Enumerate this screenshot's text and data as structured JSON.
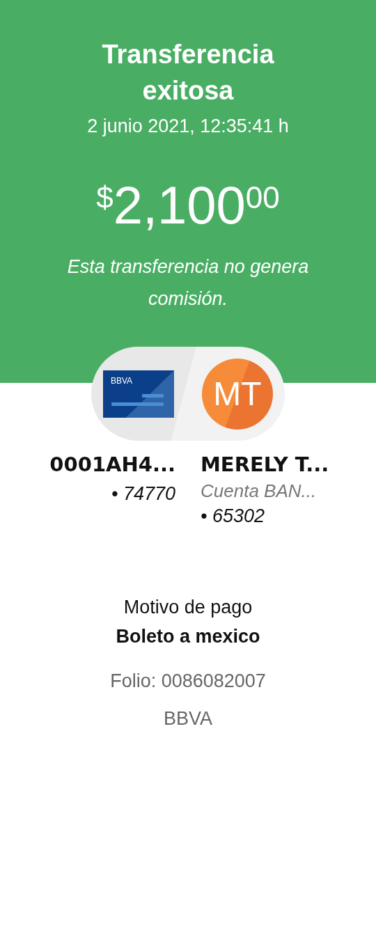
{
  "header": {
    "title": "Transferencia exitosa",
    "datetime": "2 junio 2021, 12:35:41 h",
    "amount": {
      "currency": "$",
      "integer": "2,100",
      "cents": "00"
    },
    "note": "Esta transferencia no genera comisión."
  },
  "origin": {
    "card_logo": "BBVA",
    "name": "0001AH4...",
    "number": "• 74770"
  },
  "destination": {
    "initials": "MT",
    "name": "MERELY T...",
    "account": "Cuenta BAN...",
    "number": "• 65302"
  },
  "details": {
    "label": "Motivo de pago",
    "value": "Boleto a mexico",
    "folio": "Folio: 0086082007",
    "bank": "BBVA"
  }
}
